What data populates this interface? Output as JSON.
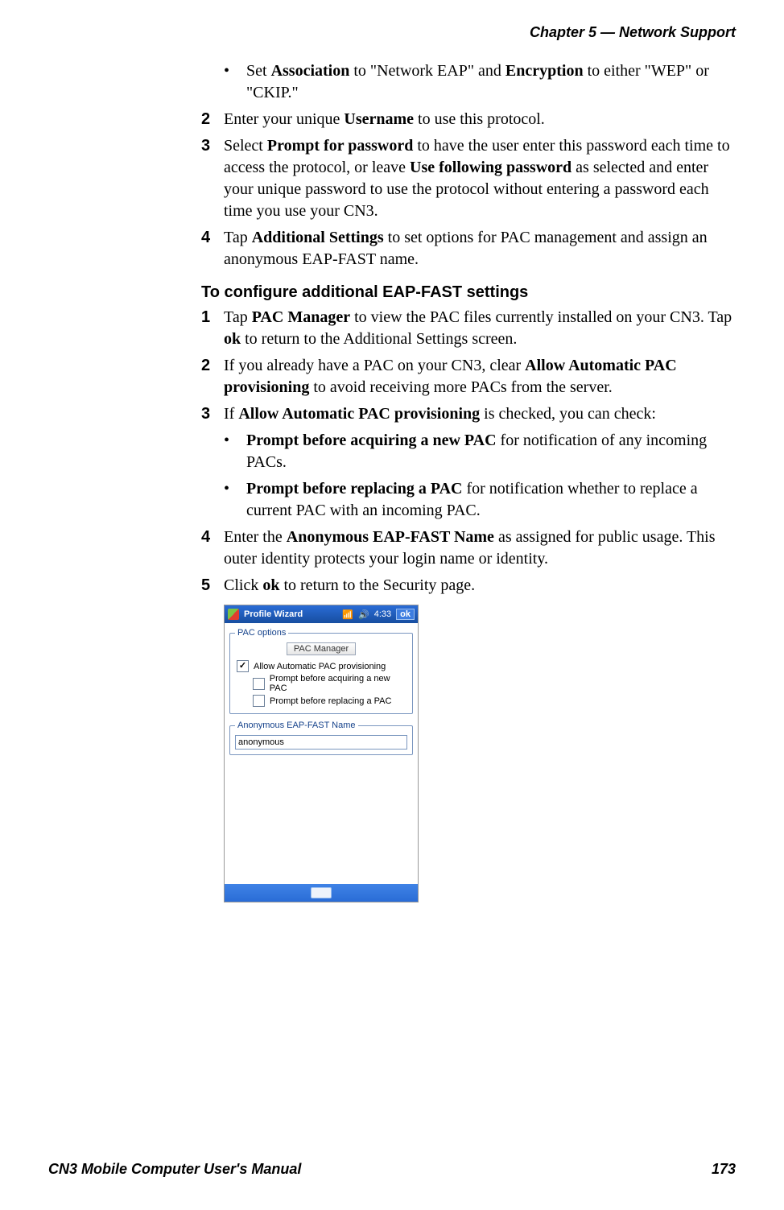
{
  "header": {
    "chapter": "Chapter 5 —  Network Support"
  },
  "content": {
    "bullet1_pre": "Set ",
    "bullet1_b1": "Association",
    "bullet1_mid": " to \"Network EAP\" and ",
    "bullet1_b2": "Encryption",
    "bullet1_post": " to either \"WEP\" or \"CKIP.\"",
    "s2_num": "2",
    "s2_pre": "Enter your unique ",
    "s2_b": "Username",
    "s2_post": " to use this protocol.",
    "s3_num": "3",
    "s3_pre": "Select ",
    "s3_b1": "Prompt for password",
    "s3_mid": " to have the user enter this password each time to access the protocol, or leave ",
    "s3_b2": "Use following password",
    "s3_post": " as selected and enter your unique password to use the protocol without entering a password each time you use your CN3.",
    "s4_num": "4",
    "s4_pre": "Tap ",
    "s4_b": "Additional Settings",
    "s4_post": " to set options for PAC management and assign an anonymous EAP-FAST name.",
    "subhead": "To configure additional EAP-FAST settings",
    "a1_num": "1",
    "a1_pre": "Tap ",
    "a1_b1": "PAC Manager",
    "a1_mid": " to view the PAC files currently installed on your CN3. Tap ",
    "a1_b2": "ok",
    "a1_post": " to return to the Additional Settings screen.",
    "a2_num": "2",
    "a2_pre": "If you already have a PAC on your CN3, clear ",
    "a2_b": "Allow Automatic PAC provisioning",
    "a2_post": " to avoid receiving more PACs from the server.",
    "a3_num": "3",
    "a3_pre": "If ",
    "a3_b": "Allow Automatic PAC provisioning",
    "a3_post": " is checked, you can check:",
    "a3b1_b": "Prompt before acquiring a new PAC",
    "a3b1_post": " for notification of any incoming PACs.",
    "a3b2_b": "Prompt before replacing a PAC",
    "a3b2_post": " for notification whether to replace a current PAC with an incoming PAC.",
    "a4_num": "4",
    "a4_pre": "Enter the ",
    "a4_b": "Anonymous EAP-FAST Name",
    "a4_post": " as assigned for public usage. This outer identity protects your login name or identity.",
    "a5_num": "5",
    "a5_pre": "Click ",
    "a5_b": "ok",
    "a5_post": " to return to the Security page."
  },
  "screenshot": {
    "titlebar": {
      "title": "Profile Wizard",
      "time": "4:33",
      "ok": "ok"
    },
    "group1": {
      "legend": "PAC options",
      "pac_manager_btn": "PAC Manager",
      "chk_allow": "Allow Automatic PAC provisioning",
      "chk_acquire": "Prompt before acquiring a new PAC",
      "chk_replace": "Prompt before replacing a PAC"
    },
    "group2": {
      "legend": "Anonymous EAP-FAST Name",
      "value": "anonymous"
    }
  },
  "footer": {
    "left": "CN3 Mobile Computer User's Manual",
    "right": "173"
  },
  "glyphs": {
    "bullet": "•",
    "signal": "📶",
    "speaker": "🔊"
  }
}
